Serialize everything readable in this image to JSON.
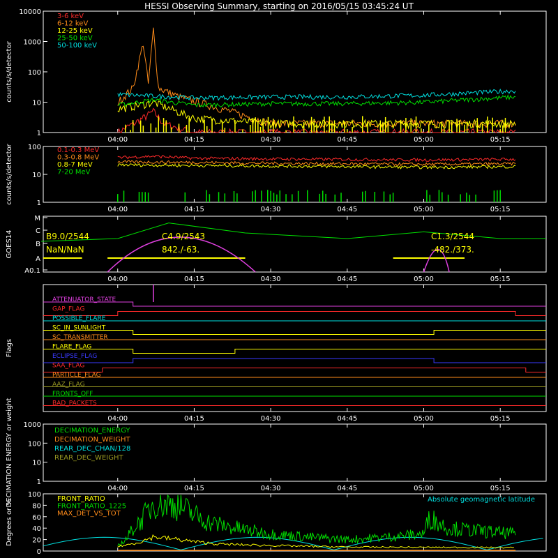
{
  "title": "HESSI Observing Summary, starting on 2016/05/15 03:45:24 UT",
  "time_ticks": [
    "04:00",
    "04:15",
    "04:30",
    "04:45",
    "05:00",
    "05:15"
  ],
  "chart_data": [
    {
      "type": "line",
      "ylabel": "counts/s/detector",
      "yscale": "log",
      "ylim": [
        1,
        10000
      ],
      "y_ticks": [
        "1",
        "10",
        "100",
        "1000",
        "10000"
      ],
      "xlim": [
        "03:45:24",
        "05:24"
      ],
      "series": [
        {
          "name": "3-6 keV",
          "color": "#ff2a2a",
          "points": [
            [
              "04:00",
              1
            ],
            [
              "04:05",
              3
            ],
            [
              "04:07",
              5
            ],
            [
              "04:09",
              2
            ],
            [
              "04:15",
              1
            ]
          ]
        },
        {
          "name": "6-12 keV",
          "color": "#ff8c1a",
          "points": [
            [
              "04:00",
              10
            ],
            [
              "04:03",
              30
            ],
            [
              "04:05",
              900
            ],
            [
              "04:06",
              40
            ],
            [
              "04:07",
              2500
            ],
            [
              "04:08",
              30
            ],
            [
              "04:12",
              15
            ],
            [
              "04:18",
              8
            ],
            [
              "04:30",
              2
            ]
          ]
        },
        {
          "name": "12-25 keV",
          "color": "#ffff00",
          "points": [
            [
              "04:00",
              6
            ],
            [
              "04:07",
              10
            ],
            [
              "04:15",
              3
            ],
            [
              "04:30",
              2
            ],
            [
              "05:00",
              2
            ],
            [
              "05:18",
              2
            ]
          ]
        },
        {
          "name": "25-50 keV",
          "color": "#00e000",
          "points": [
            [
              "04:00",
              8
            ],
            [
              "04:07",
              12
            ],
            [
              "04:15",
              8
            ],
            [
              "04:30",
              9
            ],
            [
              "04:45",
              9
            ],
            [
              "05:00",
              10
            ],
            [
              "05:18",
              15
            ]
          ]
        },
        {
          "name": "50-100 keV",
          "color": "#00e0e0",
          "points": [
            [
              "04:00",
              18
            ],
            [
              "04:15",
              14
            ],
            [
              "04:30",
              15
            ],
            [
              "04:45",
              15
            ],
            [
              "05:00",
              17
            ],
            [
              "05:18",
              24
            ]
          ]
        }
      ]
    },
    {
      "type": "line",
      "ylabel": "counts/s/detector",
      "yscale": "log",
      "ylim": [
        1,
        100
      ],
      "y_ticks": [
        "1",
        "10",
        "100"
      ],
      "series": [
        {
          "name": "0.1-0.3 MeV",
          "color": "#ff2a2a",
          "points": [
            [
              "04:00",
              40
            ],
            [
              "04:07",
              45
            ],
            [
              "04:15",
              38
            ],
            [
              "04:30",
              36
            ],
            [
              "05:00",
              33
            ],
            [
              "05:18",
              35
            ]
          ]
        },
        {
          "name": "0.3-0.8 MeV",
          "color": "#ff8c1a",
          "points": [
            [
              "04:00",
              28
            ],
            [
              "04:15",
              27
            ],
            [
              "04:30",
              25
            ],
            [
              "05:00",
              23
            ],
            [
              "05:18",
              24
            ]
          ]
        },
        {
          "name": "0.8-7 MeV",
          "color": "#ffff00",
          "points": [
            [
              "04:00",
              22
            ],
            [
              "04:15",
              21
            ],
            [
              "04:30",
              20
            ],
            [
              "05:00",
              18
            ],
            [
              "05:18",
              19
            ]
          ]
        },
        {
          "name": "7-20 MeV",
          "color": "#00e000",
          "points": [
            [
              "04:00",
              1
            ],
            [
              "05:18",
              1
            ]
          ]
        }
      ]
    },
    {
      "type": "line",
      "ylabel": "GOES14",
      "y_ticks": [
        "A0.1",
        "A",
        "B",
        "C",
        "M"
      ],
      "annotations": [
        {
          "text": "B9.0/2544",
          "time": "03:45"
        },
        {
          "text": "NaN/NaN",
          "time": "03:45"
        },
        {
          "text": "C4.9/2543",
          "time": "04:17"
        },
        {
          "text": "842./-63.",
          "time": "04:17"
        },
        {
          "text": "C1.3/2544",
          "time": "05:04"
        },
        {
          "text": "-482./373.",
          "time": "05:04"
        }
      ],
      "goes_level": [
        [
          "03:45",
          0.55
        ],
        [
          "04:00",
          0.6
        ],
        [
          "04:10",
          0.88
        ],
        [
          "04:25",
          0.7
        ],
        [
          "04:45",
          0.6
        ],
        [
          "05:00",
          0.72
        ],
        [
          "05:15",
          0.6
        ],
        [
          "05:24",
          0.6
        ]
      ]
    },
    {
      "type": "table",
      "ylabel": "Flags",
      "flags": [
        {
          "name": "ATTENUATOR_STATE",
          "color": "#e040e0"
        },
        {
          "name": "GAP_FLAG",
          "color": "#ff2a2a"
        },
        {
          "name": "POSSIBLE_FLARE",
          "color": "#00e0e0"
        },
        {
          "name": "SC_IN_SUNLIGHT",
          "color": "#ffff00"
        },
        {
          "name": "SC_TRANSMITTER",
          "color": "#ff8c1a"
        },
        {
          "name": "FLARE_FLAG",
          "color": "#ffff00"
        },
        {
          "name": "ECLIPSE_FLAG",
          "color": "#3a3aff"
        },
        {
          "name": "SAA_FLAG",
          "color": "#ff2a2a"
        },
        {
          "name": "PARTICLE_FLAG",
          "color": "#ff8c1a"
        },
        {
          "name": "AAZ_FLAG",
          "color": "#999922"
        },
        {
          "name": "FRONTS_OFF",
          "color": "#00e000"
        },
        {
          "name": "BAD_PACKETS",
          "color": "#ff2a2a"
        }
      ]
    },
    {
      "type": "line",
      "ylabel": "DECIMATION ENERGY or weight",
      "yscale": "log",
      "y_ticks": [
        "1",
        "10",
        "100",
        "1000"
      ],
      "series": [
        {
          "name": "DECIMATION_ENERGY",
          "color": "#00e000"
        },
        {
          "name": "DECIMATION_WEIGHT",
          "color": "#ff8c1a"
        },
        {
          "name": "REAR_DEC_CHAN/128",
          "color": "#00e0e0"
        },
        {
          "name": "REAR_DEC_WEIGHT",
          "color": "#999922"
        }
      ]
    },
    {
      "type": "line",
      "ylabel": "Degrees or %",
      "ylim": [
        0,
        100
      ],
      "y_ticks": [
        "0",
        "20",
        "40",
        "60",
        "80",
        "100"
      ],
      "note": "Absolute geomagnetic latitude",
      "series": [
        {
          "name": "FRONT_RATIO",
          "color": "#ffff00"
        },
        {
          "name": "FRONT_RATIO_1225",
          "color": "#00e000"
        },
        {
          "name": "MAX_DET_VS_TOT",
          "color": "#ff8c1a"
        }
      ]
    }
  ]
}
